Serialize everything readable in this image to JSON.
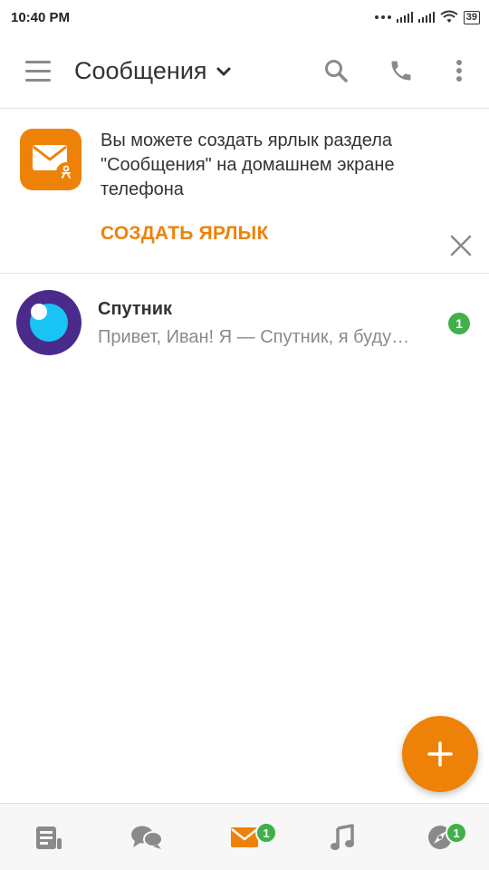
{
  "status_bar": {
    "time": "10:40 PM",
    "battery": "39"
  },
  "toolbar": {
    "title": "Сообщения"
  },
  "banner": {
    "text": "Вы можете создать ярлык раздела \"Сообщения\" на домашнем экране телефона",
    "cta": "СОЗДАТЬ ЯРЛЫК"
  },
  "chats": [
    {
      "name": "Спутник",
      "preview": "Привет, Иван! Я — Спутник, я буду…",
      "unread": "1"
    }
  ],
  "bottom_nav": {
    "items": [
      {
        "icon": "feed-icon",
        "badge": ""
      },
      {
        "icon": "discussions-icon",
        "badge": ""
      },
      {
        "icon": "messages-icon",
        "badge": "1"
      },
      {
        "icon": "music-icon",
        "badge": ""
      },
      {
        "icon": "discover-icon",
        "badge": "1"
      }
    ]
  },
  "colors": {
    "accent": "#ee8208",
    "badge": "#41b04a",
    "active_tab": "#ee8208",
    "inactive_icon": "#8a8a8a"
  }
}
